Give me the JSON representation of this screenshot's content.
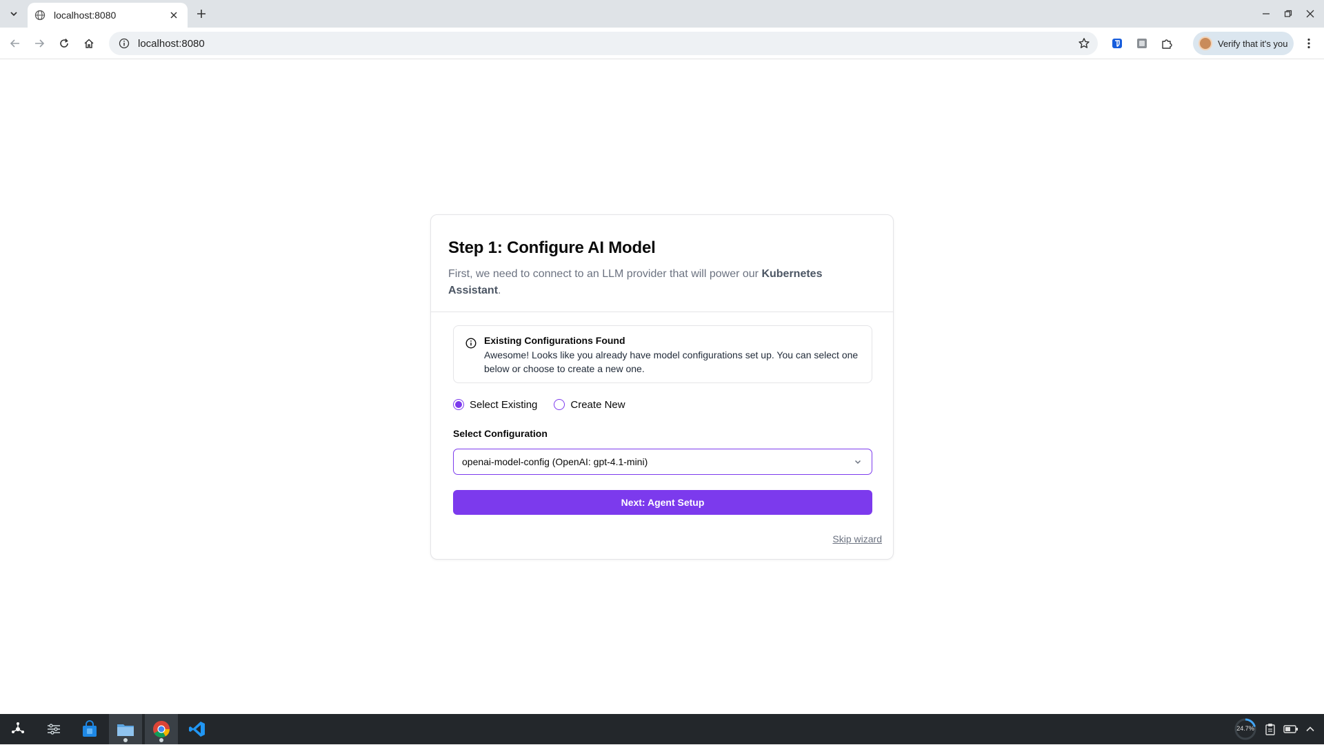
{
  "browser": {
    "tab_title": "localhost:8080",
    "url": "localhost:8080",
    "profile_label": "Verify that it's you"
  },
  "wizard": {
    "title": "Step 1: Configure AI Model",
    "description_prefix": "First, we need to connect to an LLM provider that will power our ",
    "description_bold": "Kubernetes Assistant",
    "description_suffix": ".",
    "alert": {
      "title": "Existing Configurations Found",
      "body": "Awesome! Looks like you already have model configurations set up. You can select one below or choose to create a new one."
    },
    "radio_options": [
      {
        "label": "Select Existing",
        "selected": true
      },
      {
        "label": "Create New",
        "selected": false
      }
    ],
    "select_label": "Select Configuration",
    "select_value": "openai-model-config (OpenAI: gpt-4.1-mini)",
    "next_button": "Next: Agent Setup",
    "skip_link": "Skip wizard"
  },
  "taskbar": {
    "cpu_readout": "24.7%"
  },
  "colors": {
    "accent": "#7c3aed",
    "taskbar": "#23272b",
    "tabstrip": "#dfe3e7"
  }
}
